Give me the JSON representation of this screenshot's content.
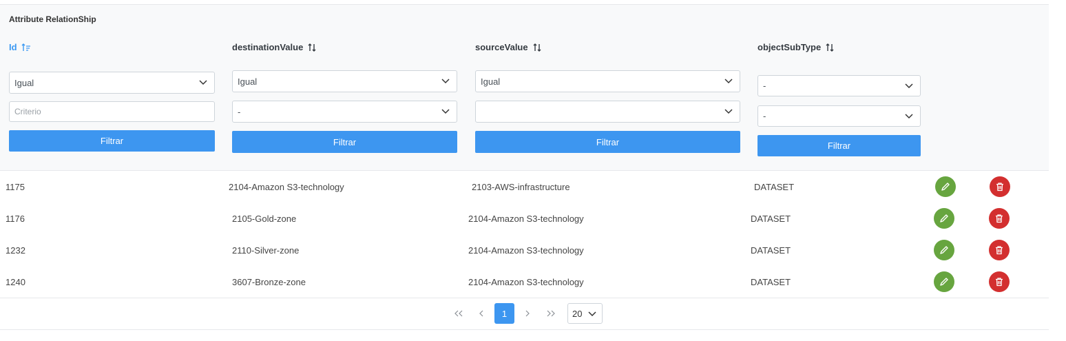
{
  "panel": {
    "title": "Attribute RelationShip"
  },
  "columns": [
    {
      "label": "Id"
    },
    {
      "label": "destinationValue"
    },
    {
      "label": "sourceValue"
    },
    {
      "label": "objectSubType"
    }
  ],
  "filters": {
    "id": {
      "mode": "Igual",
      "criteria_placeholder": "Criterio",
      "button": "Filtrar"
    },
    "destinationValue": {
      "mode": "Igual",
      "value": "-",
      "button": "Filtrar"
    },
    "sourceValue": {
      "mode": "Igual",
      "value": "",
      "button": "Filtrar"
    },
    "objectSubType": {
      "mode": "-",
      "value": "-",
      "button": "Filtrar"
    }
  },
  "rows": [
    {
      "id": "1175",
      "destination": "2104-Amazon S3-technology",
      "source": "2103-AWS-infrastructure",
      "subtype": "DATASET"
    },
    {
      "id": "1176",
      "destination": "2105-Gold-zone",
      "source": "2104-Amazon S3-technology",
      "subtype": "DATASET"
    },
    {
      "id": "1232",
      "destination": "2110-Silver-zone",
      "source": "2104-Amazon S3-technology",
      "subtype": "DATASET"
    },
    {
      "id": "1240",
      "destination": "3607-Bronze-zone",
      "source": "2104-Amazon S3-technology",
      "subtype": "DATASET"
    }
  ],
  "pagination": {
    "first": "«",
    "prev": "‹",
    "current": "1",
    "next": "›",
    "last": "»",
    "page_size": "20"
  },
  "icons": {
    "edit": "pencil-icon",
    "delete": "trash-icon",
    "sort": "sort-icon",
    "dropdown": "chevron-down-icon"
  },
  "colors": {
    "accent": "#3d96f0",
    "edit": "#67a53f",
    "delete": "#d32f2f",
    "header_bg": "#f8f9fa"
  }
}
